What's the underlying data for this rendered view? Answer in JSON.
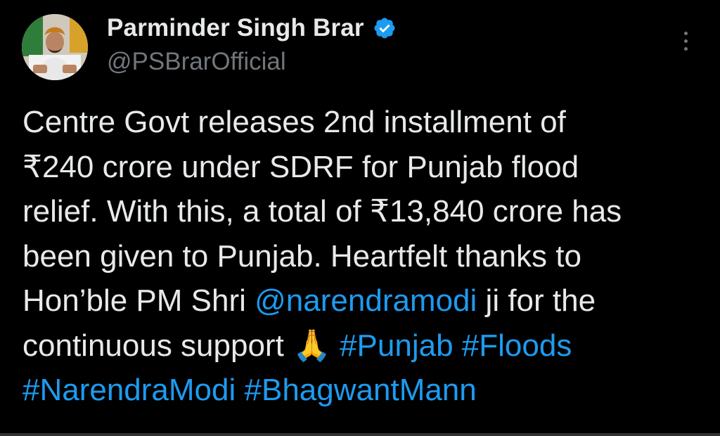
{
  "author": {
    "name": "Parminder Singh Brar",
    "handle": "@PSBrarOfficial"
  },
  "icons": {
    "avatar": "profile-photo",
    "verified": "verified-badge-icon",
    "more": "more-options-icon"
  },
  "colors": {
    "background": "#000000",
    "text": "#e7e9ea",
    "muted": "#71767b",
    "link": "#1d9bf0",
    "verified": "#1d9bf0"
  },
  "tweet": {
    "segments": [
      {
        "type": "text",
        "text": "Centre Govt releases 2nd installment of\n₹240 crore under SDRF for Punjab flood\nrelief. With this, a total of ₹13,840 crore has\nbeen given to Punjab. Heartfelt thanks to\nHon’ble PM Shri "
      },
      {
        "type": "mention",
        "text": "@narendramodi"
      },
      {
        "type": "text",
        "text": " ji for the\ncontinuous support "
      },
      {
        "type": "emoji",
        "text": "🙏"
      },
      {
        "type": "text",
        "text": " "
      },
      {
        "type": "hashtag",
        "text": "#Punjab"
      },
      {
        "type": "text",
        "text": " "
      },
      {
        "type": "hashtag",
        "text": "#Floods"
      },
      {
        "type": "text",
        "text": "\n"
      },
      {
        "type": "hashtag",
        "text": "#NarendraModi"
      },
      {
        "type": "text",
        "text": " "
      },
      {
        "type": "hashtag",
        "text": "#BhagwantMann"
      }
    ]
  }
}
